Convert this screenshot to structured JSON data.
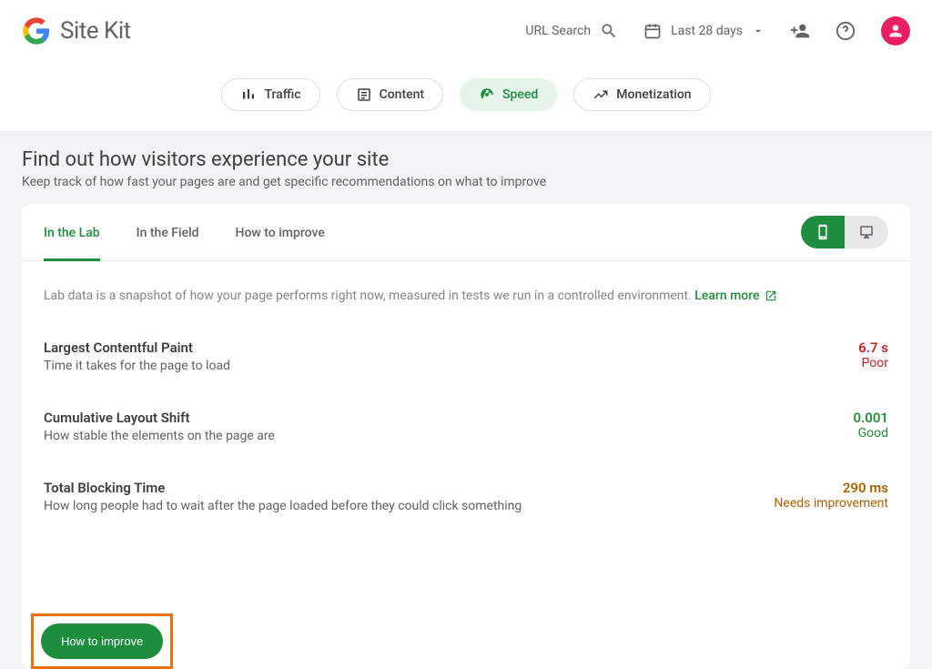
{
  "header": {
    "logo_text": "Site Kit",
    "url_search": "URL Search",
    "date_range": "Last 28 days"
  },
  "tabs": {
    "traffic": "Traffic",
    "content": "Content",
    "speed": "Speed",
    "monetization": "Monetization"
  },
  "section": {
    "title": "Find out how visitors experience your site",
    "subtitle": "Keep track of how fast your pages are and get specific recommendations on what to improve"
  },
  "subtabs": {
    "lab": "In the Lab",
    "field": "In the Field",
    "howto": "How to improve"
  },
  "lab_desc": {
    "text": "Lab data is a snapshot of how your page performs right now, measured in tests we run in a controlled environment. ",
    "link": "Learn more"
  },
  "metrics": [
    {
      "name": "Largest Contentful Paint",
      "desc": "Time it takes for the page to load",
      "value": "6.7 s",
      "rating": "Poor",
      "cls": "poor"
    },
    {
      "name": "Cumulative Layout Shift",
      "desc": "How stable the elements on the page are",
      "value": "0.001",
      "rating": "Good",
      "cls": "good"
    },
    {
      "name": "Total Blocking Time",
      "desc": "How long people had to wait after the page loaded before they could click something",
      "value": "290 ms",
      "rating": "Needs improvement",
      "cls": "ni"
    }
  ],
  "howto_button": "How to improve"
}
